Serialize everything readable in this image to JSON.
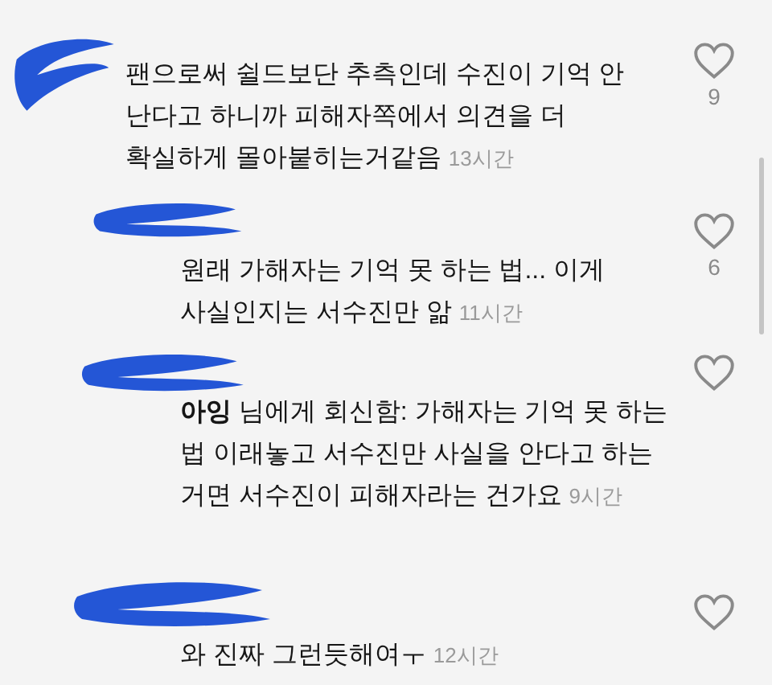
{
  "comments": [
    {
      "kind": "comment",
      "text": "팬으로써 쉴드보단 추측인데 수진이 기억 안 난다고 하니까 피해자쪽에서 의견을 더 확실하게 몰아붙히는거같음",
      "time": "13시간",
      "likes": "9"
    },
    {
      "kind": "reply",
      "text": "원래 가해자는 기억 못 하는 법... 이게 사실인지는 서수진만 앎",
      "time": "11시간",
      "likes": "6"
    },
    {
      "kind": "reply",
      "text": "**아잉** 님에게 회신함: 가해자는 기억 못 하는 법 이래놓고 서수진만 사실을 안다고 하는 거면 서수진이 피해자라는 건가요",
      "time": "9시간"
    },
    {
      "kind": "reply",
      "text": "와 진짜 그런듯해여ㅜ",
      "time": "12시간"
    }
  ]
}
